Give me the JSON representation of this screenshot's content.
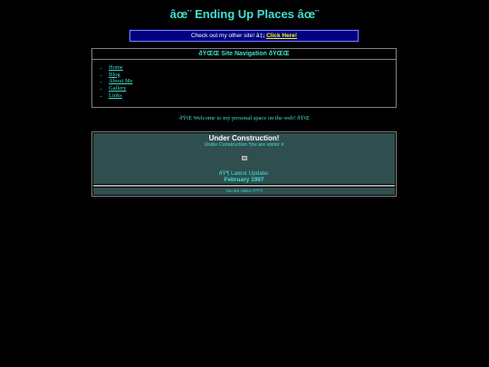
{
  "header": {
    "title": "âœ¨ Ending Up Places âœ¨"
  },
  "other_site": {
    "text": "Check out my other site! â‡¡ ",
    "link_label": "Click Here!"
  },
  "nav": {
    "header": "ðŸŒŒ Site Navigation ðŸŒŒ",
    "items": [
      {
        "label": "Home"
      },
      {
        "label": "Blog"
      },
      {
        "label": "About Me"
      },
      {
        "label": "Gallery"
      },
      {
        "label": "Links"
      }
    ]
  },
  "welcome": {
    "text": "ðŸŒ  Welcome to my personal space on the web! ðŸŒ"
  },
  "construction": {
    "title": "Under Construction!",
    "image_alt": "Under Construction",
    "visitor_text": "You are visitor #",
    "update_label": "ðŸ¶ Latest Update:",
    "update_date": "February 1997"
  },
  "footer": {
    "visitor_text": "You are visitor #???!"
  },
  "colors": {
    "background": "#000000",
    "text": "#40e0d0",
    "banner": "#000080",
    "panel": "#2f4f4f",
    "link_highlight": "#ffff00"
  }
}
